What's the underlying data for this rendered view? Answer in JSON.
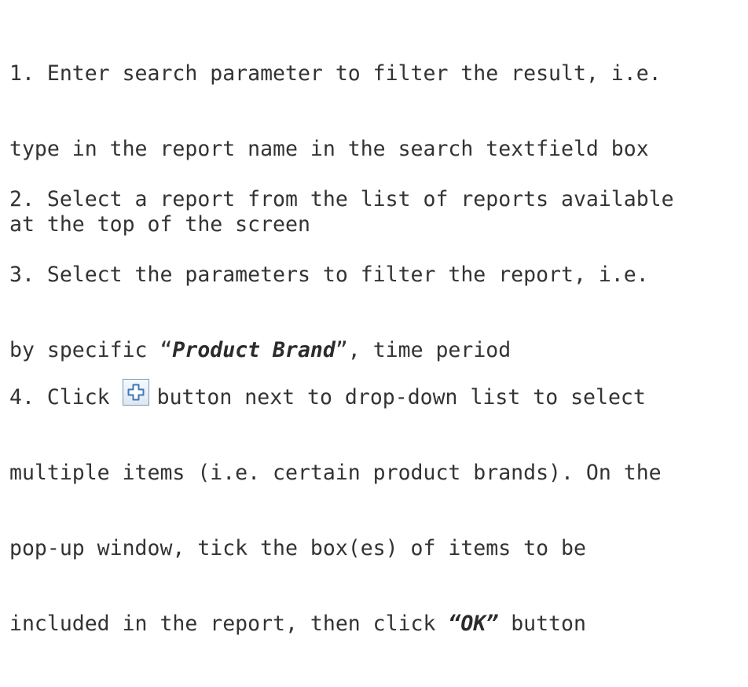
{
  "steps": [
    {
      "line1": "1. Enter search parameter to filter the result, i.e.",
      "line2": "type in the report name in the search textfield box",
      "line3": "at the top of the screen"
    },
    {
      "line1": "2. Select a report from the list of reports available"
    },
    {
      "line1": "3. Select the parameters to filter the report, i.e.",
      "line2_prefix": "by specific “",
      "line2_emph": "Product Brand",
      "line2_suffix": "”, time period"
    },
    {
      "line1_prefix": "4. Click",
      "icon": "plus-button-icon",
      "line1_suffix": "button next to drop-down list to select",
      "line2": "multiple items (i.e. certain product brands). On the",
      "line3": "pop-up window, tick the box(es) of items to be",
      "line4_prefix": "included in the report, then click ",
      "line4_emph": "“OK”",
      "line4_suffix": " button"
    }
  ],
  "colors": {
    "text": "#333333",
    "icon_border": "#7b9ab8",
    "icon_plus": "#3f78b5"
  }
}
